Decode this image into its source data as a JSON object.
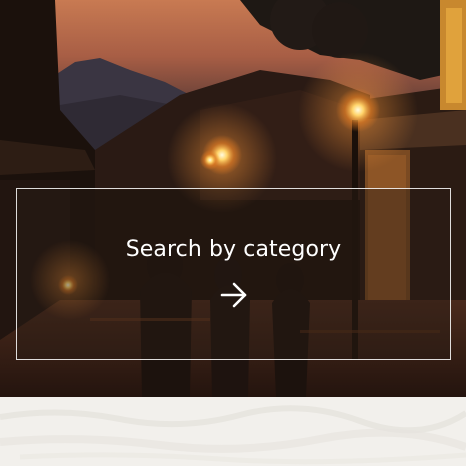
{
  "category_card": {
    "label": "Search by category",
    "arrow_icon": "arrow-right-icon"
  },
  "colors": {
    "card_text": "#ffffff",
    "card_border": "#ffffff",
    "paper_background": "#f2f0ec"
  }
}
